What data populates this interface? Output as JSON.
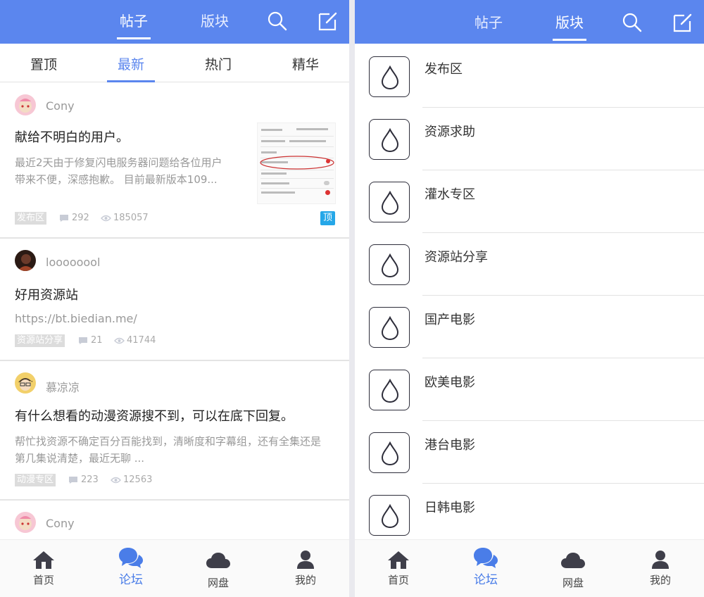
{
  "left": {
    "tabs": [
      "帖子",
      "版块"
    ],
    "subtabs": [
      "置顶",
      "最新",
      "热门",
      "精华"
    ],
    "posts": [
      {
        "author": "Cony",
        "title": "献给不明白的用户。",
        "excerpt_line1": "最近2天由于修复闪电服务器问题给各位用户",
        "excerpt_line2": "带来不便，深感抱歉。 目前最新版本109...",
        "tag": "发布区",
        "comments": "292",
        "views": "185057",
        "badge": "顶"
      },
      {
        "author": "loooooool",
        "title": "好用资源站",
        "excerpt_line1": "https://bt.biedian.me/",
        "tag": "资源站分享",
        "comments": "21",
        "views": "41744"
      },
      {
        "author": "慕凉凉",
        "title": "有什么想看的动漫资源搜不到，可以在底下回复。",
        "excerpt_line1": "帮忙找资源不确定百分百能找到，清晰度和字幕组，还有全集还是",
        "excerpt_line2": "第几集说清楚，最近无聊 ...",
        "tag": "动漫专区",
        "comments": "223",
        "views": "12563"
      },
      {
        "author": "Cony"
      }
    ]
  },
  "right": {
    "tabs": [
      "帖子",
      "版块"
    ],
    "boards": [
      "发布区",
      "资源求助",
      "灌水专区",
      "资源站分享",
      "国产电影",
      "欧美电影",
      "港台电影",
      "日韩电影"
    ]
  },
  "nav": [
    "首页",
    "论坛",
    "网盘",
    "我的"
  ],
  "colors": {
    "accent": "#5b86ee",
    "badge": "#25a7e8"
  }
}
